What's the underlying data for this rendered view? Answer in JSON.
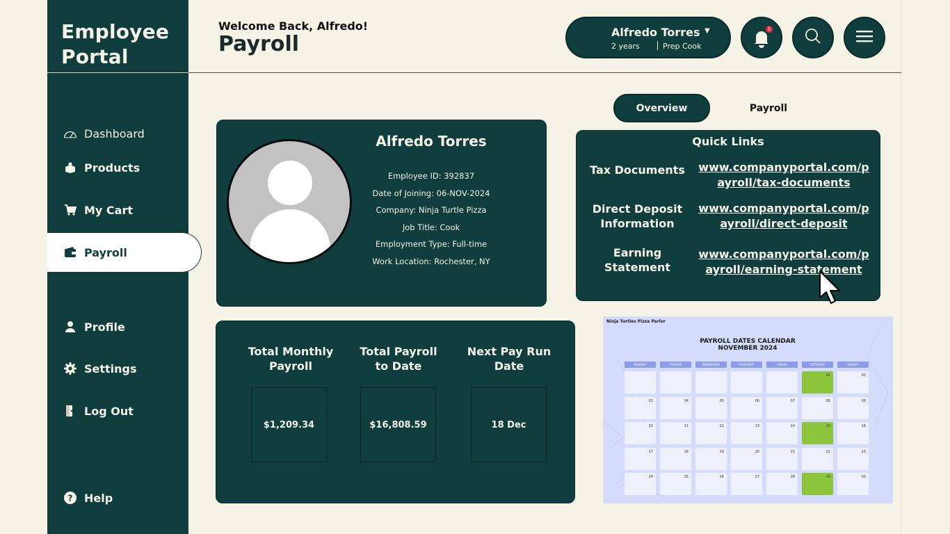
{
  "app": {
    "title_line1": "Employee",
    "title_line2": "Portal"
  },
  "header": {
    "welcome": "Welcome Back, Alfredo!",
    "title": "Payroll",
    "user": {
      "name": "Alfredo Torres",
      "tenure": "2 years",
      "role": "Prep Cook"
    },
    "notification_count": "1"
  },
  "sidebar": {
    "items": [
      {
        "label": "Dashboard",
        "icon": "gauge-icon"
      },
      {
        "label": "Products",
        "icon": "box-icon"
      },
      {
        "label": "My Cart",
        "icon": "cart-icon"
      },
      {
        "label": "Payroll",
        "icon": "wallet-icon",
        "active": true
      },
      {
        "label": "Profile",
        "icon": "person-icon"
      },
      {
        "label": "Settings",
        "icon": "gear-icon"
      },
      {
        "label": "Log Out",
        "icon": "logout-icon"
      }
    ],
    "help": "Help"
  },
  "tabs": {
    "overview": "Overview",
    "payroll": "Payroll"
  },
  "profile": {
    "name": "Alfredo Torres",
    "employee_id": "Employee ID: 392837",
    "joining": "Date of Joining: 06-NOV-2024",
    "company": "Company: Ninja Turtle Pizza",
    "job_title": "Job Title: Cook",
    "employment_type": "Employment Type: Full-time",
    "location": "Work Location: Rochester, NY"
  },
  "quick_links": {
    "title": "Quick Links",
    "links": [
      {
        "label": "Tax Documents",
        "url": "www.companyportal.com/payroll/tax-documents"
      },
      {
        "label": "Direct Deposit Information",
        "url": "www.companyportal.com/payroll/direct-deposit"
      },
      {
        "label": "Earning Statement",
        "url": "www.companyportal.com/payroll/earning-statement"
      }
    ]
  },
  "stats": {
    "monthly_title": "Total Monthly Payroll",
    "monthly_value": "$1,209.34",
    "todate_title": "Total Payroll to Date",
    "todate_value": "$16,808.59",
    "nextrun_title": "Next Pay Run Date",
    "nextrun_value": "18 Dec"
  },
  "calendar": {
    "parlor": "Ninja Turtles Pizza Parlor",
    "title_line1": "PAYROLL DATES CALENDAR",
    "title_line2": "NOVEMBER 2024",
    "days": [
      "MONDAY",
      "TUESDAY",
      "WEDNESDAY",
      "THURSDAY",
      "FRIDAY",
      "SATURDAY",
      "SUNDAY"
    ],
    "weeks": [
      [
        "",
        "",
        "",
        "",
        "",
        "01",
        "02"
      ],
      [
        "03",
        "04",
        "05",
        "06",
        "07",
        "08",
        "09"
      ],
      [
        "10",
        "11",
        "12",
        "13",
        "14",
        "15",
        "16"
      ],
      [
        "17",
        "18",
        "19",
        "20",
        "21",
        "22",
        "23"
      ],
      [
        "24",
        "25",
        "26",
        "27",
        "28",
        "29",
        "30"
      ]
    ],
    "highlighted": [
      "01",
      "15",
      "29"
    ],
    "highlight_color": "#8cc43c"
  },
  "colors": {
    "primary": "#103e3f",
    "background": "#f5f2e6",
    "text_light": "#f5f2e6"
  }
}
